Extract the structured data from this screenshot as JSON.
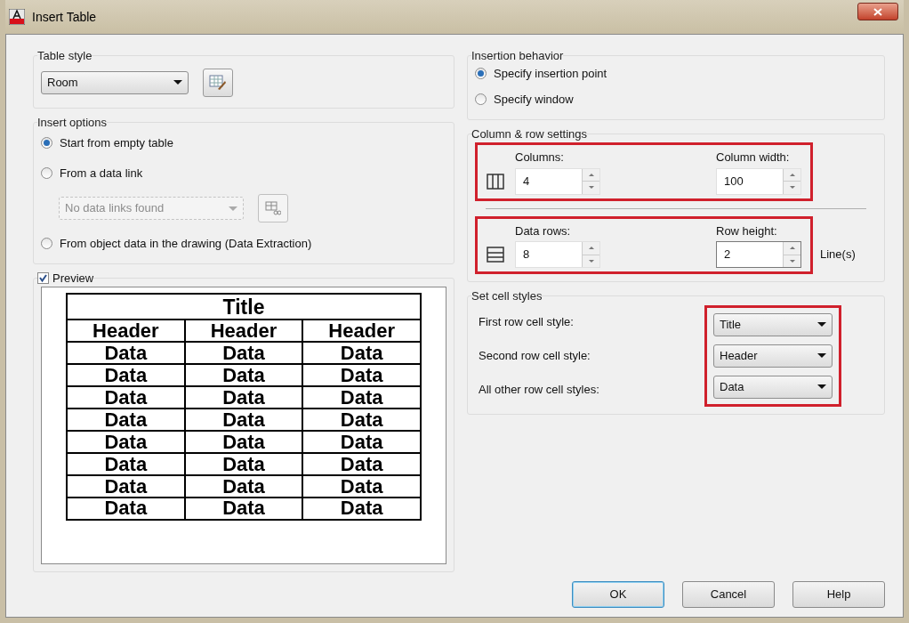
{
  "window": {
    "title": "Insert Table"
  },
  "table_style": {
    "label": "Table style",
    "value": "Room"
  },
  "insert_options": {
    "label": "Insert options",
    "options": [
      {
        "label": "Start from empty table",
        "selected": true
      },
      {
        "label": "From a data link",
        "selected": false
      },
      {
        "label": "From object data in the drawing (Data Extraction)",
        "selected": false
      }
    ],
    "data_link_select": {
      "value": "No data links found",
      "disabled": true
    }
  },
  "preview": {
    "label": "Preview",
    "checked": true,
    "table": {
      "title": "Title",
      "headers": [
        "Header",
        "Header",
        "Header"
      ],
      "rows": [
        [
          "Data",
          "Data",
          "Data"
        ],
        [
          "Data",
          "Data",
          "Data"
        ],
        [
          "Data",
          "Data",
          "Data"
        ],
        [
          "Data",
          "Data",
          "Data"
        ],
        [
          "Data",
          "Data",
          "Data"
        ],
        [
          "Data",
          "Data",
          "Data"
        ],
        [
          "Data",
          "Data",
          "Data"
        ],
        [
          "Data",
          "Data",
          "Data"
        ]
      ]
    }
  },
  "insertion_behavior": {
    "label": "Insertion behavior",
    "options": [
      {
        "label": "Specify insertion point",
        "selected": true
      },
      {
        "label": "Specify window",
        "selected": false
      }
    ]
  },
  "column_row_settings": {
    "label": "Column & row settings",
    "groups": [
      {
        "kind": "columns",
        "highlighted": true,
        "left": {
          "label": "Columns:",
          "value": "4"
        },
        "right": {
          "label": "Column width:",
          "value": "100"
        }
      },
      {
        "kind": "rows",
        "highlighted": true,
        "left": {
          "label": "Data rows:",
          "value": "8"
        },
        "right": {
          "label": "Row height:",
          "value": "2"
        },
        "unit": "Line(s)"
      }
    ]
  },
  "cell_styles": {
    "label": "Set cell styles",
    "highlighted": true,
    "rows": [
      {
        "label": "First row cell style:",
        "value": "Title"
      },
      {
        "label": "Second row cell style:",
        "value": "Header"
      },
      {
        "label": "All other row cell styles:",
        "value": "Data"
      }
    ]
  },
  "buttons": [
    {
      "label": "OK",
      "default": true
    },
    {
      "label": "Cancel",
      "default": false
    },
    {
      "label": "Help",
      "default": false
    }
  ]
}
